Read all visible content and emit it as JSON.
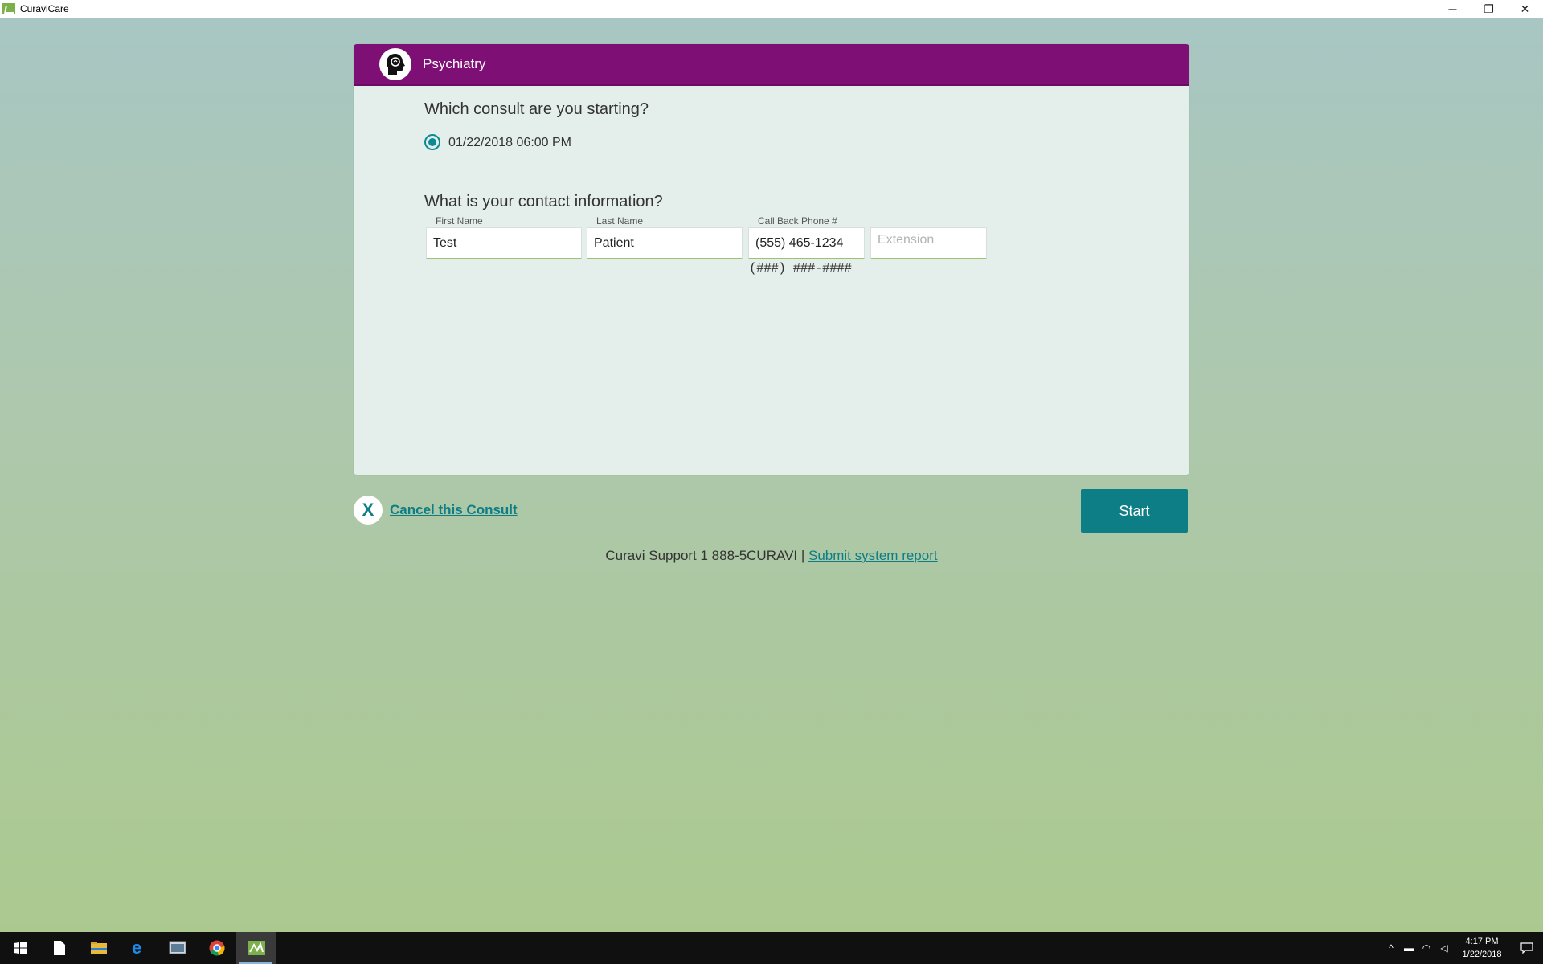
{
  "window": {
    "title": "CuraviCare",
    "minimize": "─",
    "restore": "❐",
    "close": "✕"
  },
  "header": {
    "department": "Psychiatry"
  },
  "consult": {
    "question": "Which consult are you starting?",
    "options": [
      "01/22/2018 06:00 PM"
    ]
  },
  "contact": {
    "question": "What is your contact information?",
    "first_name_label": "First Name",
    "first_name_value": "Test",
    "last_name_label": "Last Name",
    "last_name_value": "Patient",
    "phone_label": "Call Back Phone #",
    "phone_value": "(555) 465-1234",
    "phone_format_hint": "(###) ###-####",
    "extension_placeholder": "Extension"
  },
  "actions": {
    "cancel_icon": "X",
    "cancel_label": "Cancel this Consult",
    "start_label": "Start"
  },
  "support": {
    "text": "Curavi Support 1 888-5CURAVI | ",
    "report_link": "Submit system report"
  },
  "taskbar": {
    "time": "4:17 PM",
    "date": "1/22/2018",
    "apps": [
      "windows-start",
      "file",
      "file-explorer",
      "edge",
      "app-window",
      "chrome",
      "curavicare"
    ]
  }
}
